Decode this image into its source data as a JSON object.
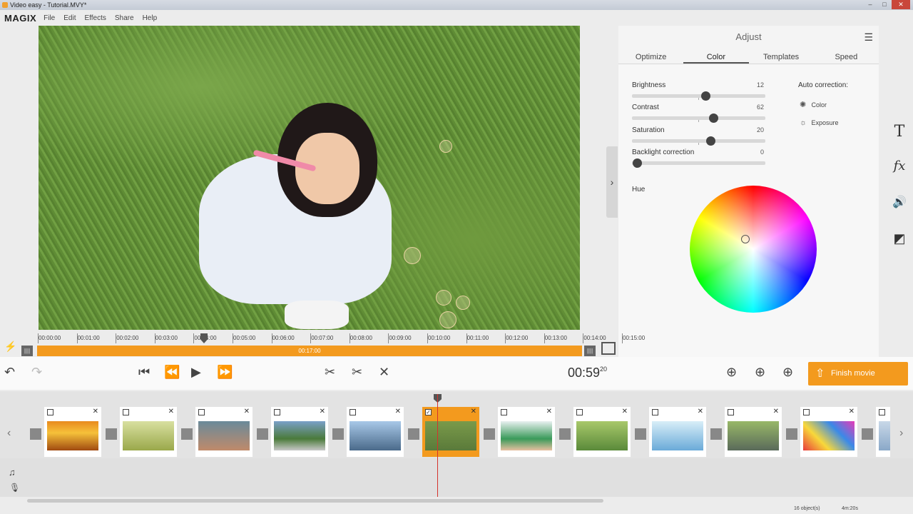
{
  "window": {
    "title": "Video easy - Tutorial.MVY*",
    "min": "–",
    "max": "□",
    "close": "✕"
  },
  "menu": {
    "logo": "MAGIX",
    "items": [
      "File",
      "Edit",
      "Effects",
      "Share",
      "Help"
    ]
  },
  "adjust": {
    "title": "Adjust",
    "tabs": [
      "Optimize",
      "Color",
      "Templates",
      "Speed"
    ],
    "active_tab": "Color",
    "sliders": [
      {
        "label": "Brightness",
        "value": "12",
        "position": 0.55
      },
      {
        "label": "Contrast",
        "value": "62",
        "position": 0.61
      },
      {
        "label": "Saturation",
        "value": "20",
        "position": 0.59
      },
      {
        "label": "Backlight correction",
        "value": "0",
        "position": 0.04
      }
    ],
    "auto_correction": {
      "label": "Auto correction:",
      "color": "Color",
      "exposure": "Exposure"
    },
    "hue_label": "Hue"
  },
  "timeline": {
    "ticks": [
      "00:00:00",
      "00:01:00",
      "00:02:00",
      "00:03:00",
      "00:04:00",
      "00:05:00",
      "00:06:00",
      "00:07:00",
      "00:08:00",
      "00:09:00",
      "00:10:00",
      "00:11:00",
      "00:12:00",
      "00:13:00",
      "00:14:00",
      "00:15:00"
    ],
    "range_duration": "00:17:00",
    "handle_glyph": "||||"
  },
  "controls": {
    "timecode_main": "00:59",
    "timecode_frames": "20",
    "finish_label": "Finish movie"
  },
  "status": {
    "objects": "16 object(s)",
    "duration": "4m:20s"
  },
  "icons": {
    "undo": "↶",
    "redo": "↷",
    "skip_start": "⏮",
    "rewind": "⏪",
    "play": "▶",
    "forward": "⏩",
    "cut": "✂",
    "split": "✂",
    "delete": "✕",
    "add_video": "⊕",
    "add_image": "⊕",
    "add_music": "⊕",
    "finish": "⇧",
    "hamburger": "☰",
    "collapse": "›",
    "text_tool": "T",
    "fx_tool": "fx",
    "audio_tool": "🔊",
    "crop_tool": "◩",
    "flash": "⚡",
    "music": "♫",
    "mic": "🎙",
    "left": "‹",
    "right": "›",
    "check": "✓",
    "close": "✕",
    "color_ac": "✺",
    "exposure_ac": "☼"
  },
  "colors": {
    "accent": "#f39a1e",
    "playhead": "#d4332c"
  }
}
